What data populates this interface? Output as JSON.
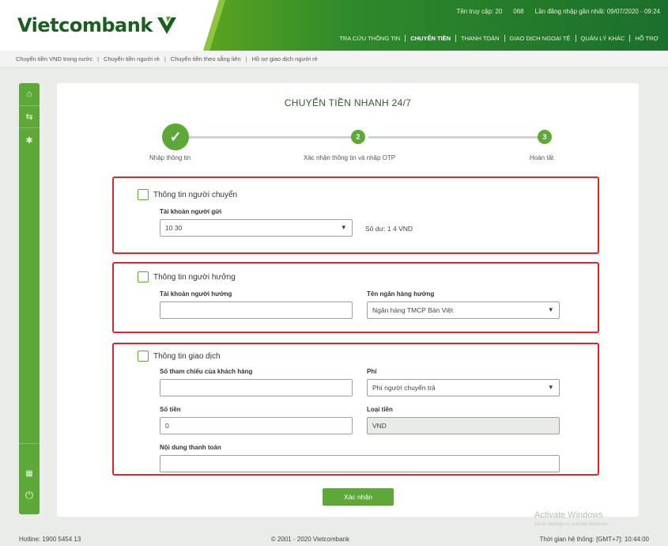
{
  "brand": {
    "name": "Vietcombank"
  },
  "header": {
    "info": [
      "Tên truy cập: 20",
      "068",
      "Lần đăng nhập gần nhất: 09/07/2020 - 09:24"
    ],
    "menu": [
      {
        "label": "TRA CỨU THÔNG TIN",
        "active": false
      },
      {
        "label": "CHUYỂN TIỀN",
        "active": true
      },
      {
        "label": "THANH TOÁN",
        "active": false
      },
      {
        "label": "GIAO DỊCH NGOẠI TỆ",
        "active": false
      },
      {
        "label": "QUẢN LÝ KHÁC",
        "active": false
      },
      {
        "label": "HỖ TRỢ",
        "active": false
      }
    ]
  },
  "breadcrumb": [
    "Chuyển tiền VND trong nước",
    "Chuyển tiền người rè",
    "Chuyển tiền theo sẵng liên",
    "Hồ sơ giao dịch người rè"
  ],
  "page": {
    "title": "CHUYỂN TIỀN NHANH 24/7",
    "steps": [
      {
        "num": "✓",
        "label": "Nhập thông tin"
      },
      {
        "num": "2",
        "label": "Xác nhận thông tin và nhập OTP"
      },
      {
        "num": "3",
        "label": "Hoàn tất"
      }
    ]
  },
  "sender": {
    "title": "Thông tin người chuyển",
    "account_label": "Tài khoản người gửi",
    "account_value": "10          30",
    "balance_text": "Số dư: 1        4 VND"
  },
  "receiver": {
    "title": "Thông tin người hưởng",
    "account_label": "Tài khoản người hưởng",
    "account_value": "",
    "bank_label": "Tên ngân hàng hưởng",
    "bank_value": "Ngân hàng TMCP Bản Việt"
  },
  "transaction": {
    "title": "Thông tin giao dịch",
    "phone_label": "Số tham chiếu của khách hàng",
    "phone_value": "",
    "fee_label": "Phí",
    "fee_value": "Phí người chuyển trả",
    "amount_label": "Số tiền",
    "amount_value": "0",
    "currency_label": "Loại tiền",
    "currency_value": "VND",
    "content_label": "Nội dung thanh toán",
    "content_value": ""
  },
  "confirm_label": "Xác nhận",
  "watermark": {
    "title": "Activate Windows",
    "sub": "Go to Settings to activate Windows."
  },
  "footer": {
    "hotline": "Hotline: 1900 5454 13",
    "copyright": "© 2001 - 2020 Vietcombank",
    "timezone": "Thời gian hệ thống: [GMT+7]: 10:44:00"
  },
  "colors": {
    "brand_green": "#5ea83a",
    "dark_green": "#1a5e20",
    "highlight_red": "#e0242b"
  }
}
